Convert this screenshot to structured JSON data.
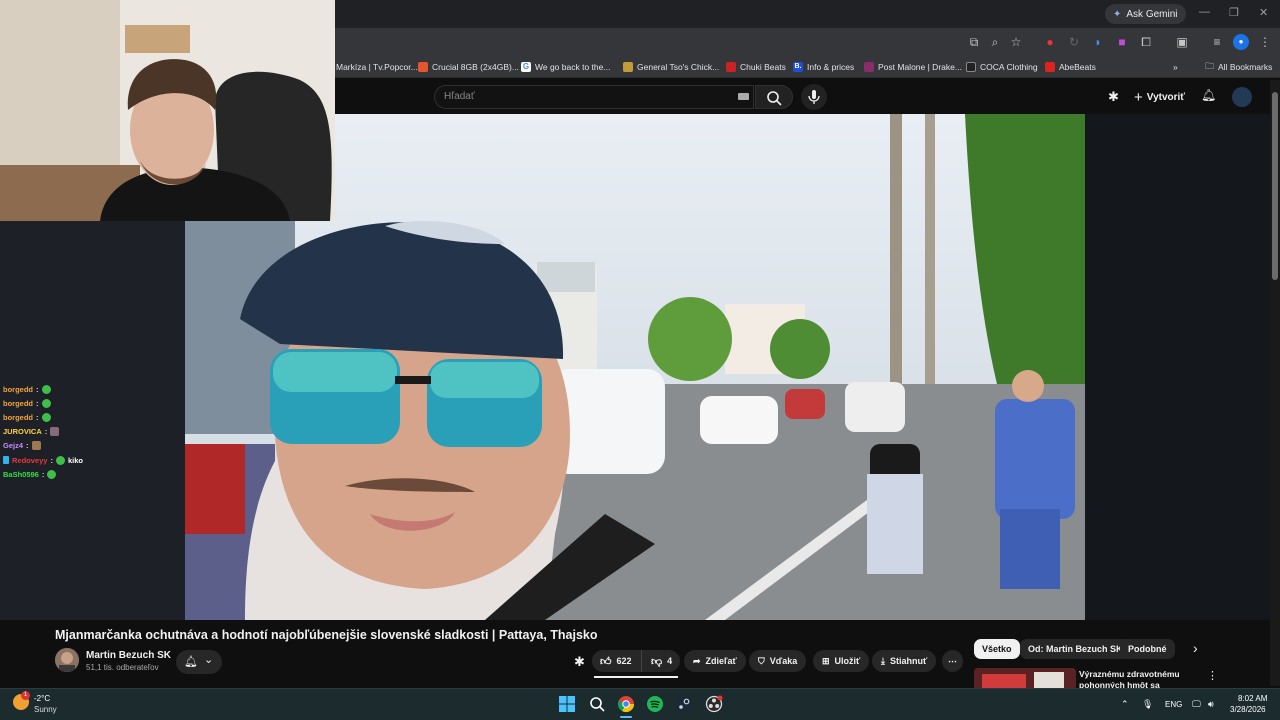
{
  "browser": {
    "ask_gemini": "Ask Gemini",
    "bookmarks": [
      {
        "label": "Markíza | Tv.Popcor...",
        "color": "#444"
      },
      {
        "label": "Crucial 8GB (2x4GB)...",
        "color": "#e4572e"
      },
      {
        "label": "We go back to the...",
        "color": "#4285f4"
      },
      {
        "label": "General Tso's Chick...",
        "color": "#c49a3a"
      },
      {
        "label": "Chuki Beats",
        "color": "#c22"
      },
      {
        "label": "Info & prices",
        "color": "#1e4fd8"
      },
      {
        "label": "Post Malone | Drake...",
        "color": "#8a2b6a"
      },
      {
        "label": "COCA Clothing",
        "color": "#222"
      },
      {
        "label": "AbeBeats",
        "color": "#d22"
      }
    ],
    "all_bookmarks": "All Bookmarks"
  },
  "youtube": {
    "search_placeholder": "Hľadať",
    "create_label": "Vytvoriť",
    "video_title": "Mjanmarčanka ochutnáva a hodnotí najobľúbenejšie slovenské sladkosti | Pattaya, Thajsko",
    "channel_name": "Martin Bezuch SK",
    "subscribers": "51,1 tis. odberateľov",
    "likes": "622",
    "dislikes": "4",
    "actions": {
      "share": "Zdieľať",
      "thanks": "Vďaka",
      "save": "Uložiť",
      "download": "Stiahnuť"
    },
    "chips": [
      "Všetko",
      "Od: Martin Bezuch SK",
      "Podobné"
    ],
    "recommended_title": "Výraznému zdravotnému pohonných hmôt sa newybrem..."
  },
  "chat": [
    {
      "user": "borgedd",
      "color": "#f2a43a",
      "msg": ""
    },
    {
      "user": "borgedd",
      "color": "#f2a43a",
      "msg": ""
    },
    {
      "user": "borgedd",
      "color": "#f2a43a",
      "msg": ""
    },
    {
      "user": "JUROVICA",
      "color": "#ffd23f",
      "msg": ""
    },
    {
      "user": "Gejz4",
      "color": "#c98bff",
      "msg": ""
    },
    {
      "user": "Redoveyy",
      "color": "#e8393b",
      "msg": "kiko"
    },
    {
      "user": "BaSh0596",
      "color": "#3cdc4a",
      "msg": ""
    }
  ],
  "taskbar": {
    "temp": "-2°C",
    "condition": "Sunny",
    "weather_badge": "1",
    "lang": "ENG",
    "time": "8:02 AM",
    "date": "3/28/2026"
  }
}
